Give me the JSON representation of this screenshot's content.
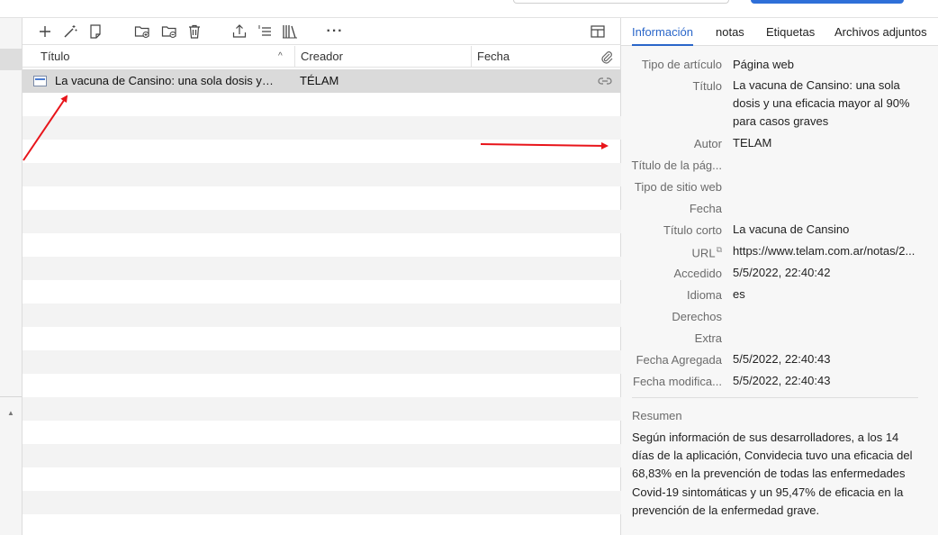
{
  "toolbar": {
    "icons": [
      "new-item-icon",
      "magic-wand-icon",
      "new-note-icon",
      "new-collection-icon",
      "remove-from-collection-icon",
      "trash-icon",
      "export-icon",
      "citation-icon",
      "library-icon",
      "more-options-icon",
      "column-picker-icon"
    ],
    "more_label": "···"
  },
  "columns": {
    "title": "Título",
    "creator": "Creador",
    "date": "Fecha"
  },
  "items": [
    {
      "title": "La vacuna de Cansino: una sola dosis y una eficacia mayor al 90% para casos graves",
      "creator": "TÉLAM",
      "date": ""
    }
  ],
  "tabs": {
    "info": "Información",
    "notes": "notas",
    "tags": "Etiquetas",
    "attachments": "Archivos adjuntos"
  },
  "info": {
    "item_type": {
      "label": "Tipo de artículo",
      "value": "Página web"
    },
    "title": {
      "label": "Título",
      "value": "La vacuna de Cansino: una sola dosis y una eficacia mayor al 90% para casos graves"
    },
    "author": {
      "label": "Autor",
      "value": "TELAM"
    },
    "page_title": {
      "label": "Título de la pág...",
      "value": ""
    },
    "site_type": {
      "label": "Tipo de sitio web",
      "value": ""
    },
    "date": {
      "label": "Fecha",
      "value": ""
    },
    "short_title": {
      "label": "Título corto",
      "value": "La vacuna de Cansino"
    },
    "url": {
      "label": "URL",
      "value": "https://www.telam.com.ar/notas/2..."
    },
    "accessed": {
      "label": "Accedido",
      "value": "5/5/2022, 22:40:42"
    },
    "language": {
      "label": "Idioma",
      "value": "es"
    },
    "rights": {
      "label": "Derechos",
      "value": ""
    },
    "extra": {
      "label": "Extra",
      "value": ""
    },
    "date_added": {
      "label": "Fecha Agregada",
      "value": "5/5/2022, 22:40:43"
    },
    "date_modified": {
      "label": "Fecha modifica...",
      "value": "5/5/2022, 22:40:43"
    }
  },
  "summary": {
    "label": "Resumen",
    "text": "Según información de sus desarrolladores, a los 14 días de la aplicación, Convidecia tuvo una eficacia del 68,83% en la prevención de todas las enfermedades Covid-19 sintomáticas y un 95,47% de eficacia en la prevención de la enfermedad grave."
  },
  "colors": {
    "accent": "#2a66c9",
    "annotation_arrow": "#e8141a",
    "selected_row": "#dadada"
  }
}
